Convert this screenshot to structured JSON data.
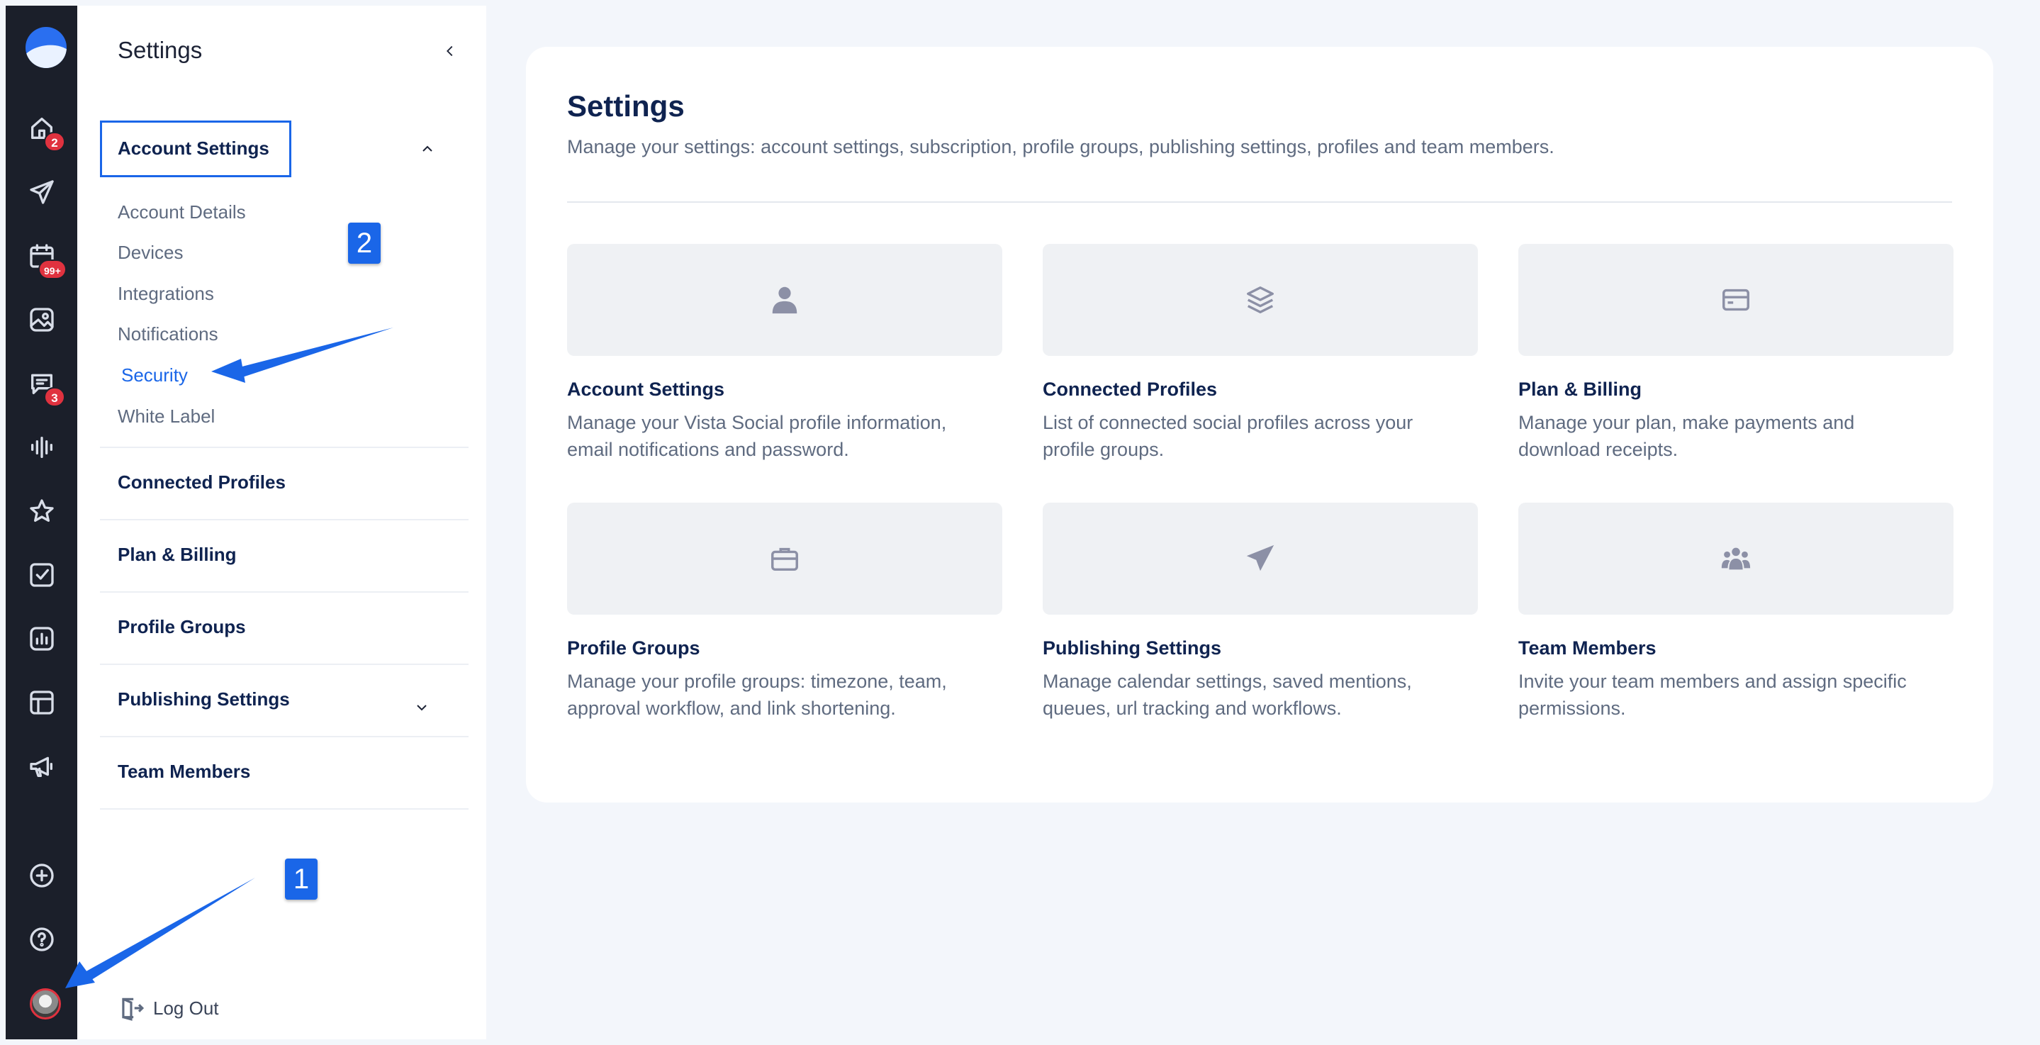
{
  "rail": {
    "badges": {
      "home": "2",
      "calendar": "99+",
      "inbox": "3"
    },
    "icons": [
      "logo",
      "home-icon",
      "send-icon",
      "calendar-icon",
      "media-icon",
      "inbox-icon",
      "listening-icon",
      "star-icon",
      "tasks-icon",
      "reports-icon",
      "layout-icon",
      "megaphone-icon",
      "add-icon",
      "help-icon",
      "avatar"
    ]
  },
  "sidebar": {
    "title": "Settings",
    "account_settings": {
      "label": "Account Settings",
      "items": [
        "Account Details",
        "Devices",
        "Integrations",
        "Notifications",
        "Security",
        "White Label"
      ],
      "active": "Security"
    },
    "sections": [
      "Connected Profiles",
      "Plan & Billing",
      "Profile Groups",
      "Publishing Settings",
      "Team Members"
    ],
    "logout": "Log Out"
  },
  "main": {
    "title": "Settings",
    "description": "Manage your settings: account settings, subscription, profile groups, publishing settings, profiles and team members.",
    "cards": [
      {
        "title": "Account Settings",
        "desc1": "Manage your Vista Social profile information,",
        "desc2": "email notifications and password.",
        "icon": "user-icon"
      },
      {
        "title": "Connected Profiles",
        "desc1": "List of connected social profiles across your",
        "desc2": "profile groups.",
        "icon": "layers-icon"
      },
      {
        "title": "Plan & Billing",
        "desc1": "Manage your plan, make payments and",
        "desc2": "download receipts.",
        "icon": "credit-card-icon"
      },
      {
        "title": "Profile Groups",
        "desc1": "Manage your profile groups: timezone, team,",
        "desc2": "approval workflow, and link shortening.",
        "icon": "briefcase-icon"
      },
      {
        "title": "Publishing Settings",
        "desc1": "Manage calendar settings, saved mentions,",
        "desc2": "queues, url tracking and workflows.",
        "icon": "paper-plane-icon"
      },
      {
        "title": "Team Members",
        "desc1": "Invite your team members and assign specific",
        "desc2": "permissions.",
        "icon": "users-icon"
      }
    ]
  },
  "annotations": {
    "callout1": "1",
    "callout2": "2"
  },
  "colors": {
    "rail": "#1b1f2a",
    "accent": "#1a66e8",
    "badge": "#e0323f",
    "heading": "#0f2350"
  }
}
